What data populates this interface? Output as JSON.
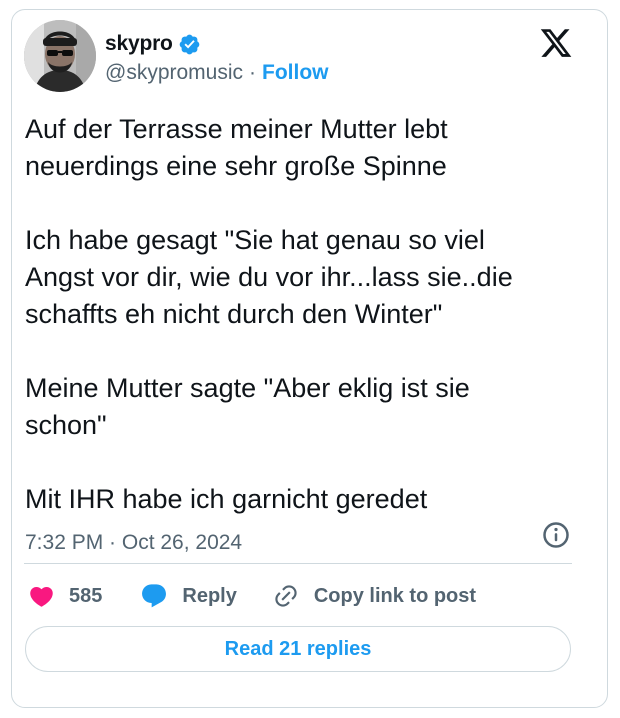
{
  "author": {
    "display_name": "skypro",
    "handle": "@skypromusic",
    "separator": "·",
    "follow_label": "Follow",
    "verified": true
  },
  "tweet": {
    "paragraphs": [
      "Auf der Terrasse meiner Mutter lebt\nneuerdings eine sehr große Spinne",
      "Ich habe gesagt \"Sie hat genau so viel\nAngst vor dir, wie du vor ihr...lass sie..die\nschaffts eh nicht durch den Winter\"",
      "Meine Mutter sagte \"Aber eklig ist sie\nschon\"",
      "Mit IHR habe ich garnicht geredet"
    ],
    "timestamp": "7:32 PM · Oct 26, 2024"
  },
  "actions": {
    "like_count": "585",
    "reply_label": "Reply",
    "copy_link_label": "Copy link to post",
    "read_replies_label": "Read 21 replies"
  },
  "icons": {
    "x_logo": "x-logo-icon",
    "verified": "verified-badge-icon",
    "info": "info-icon",
    "like": "heart-icon",
    "reply": "speech-bubble-icon",
    "copy": "link-icon"
  },
  "colors": {
    "accent": "#1d9bf0",
    "like": "#f91880",
    "text_primary": "#0f1419",
    "text_secondary": "#536471",
    "border": "#cfd9de"
  }
}
